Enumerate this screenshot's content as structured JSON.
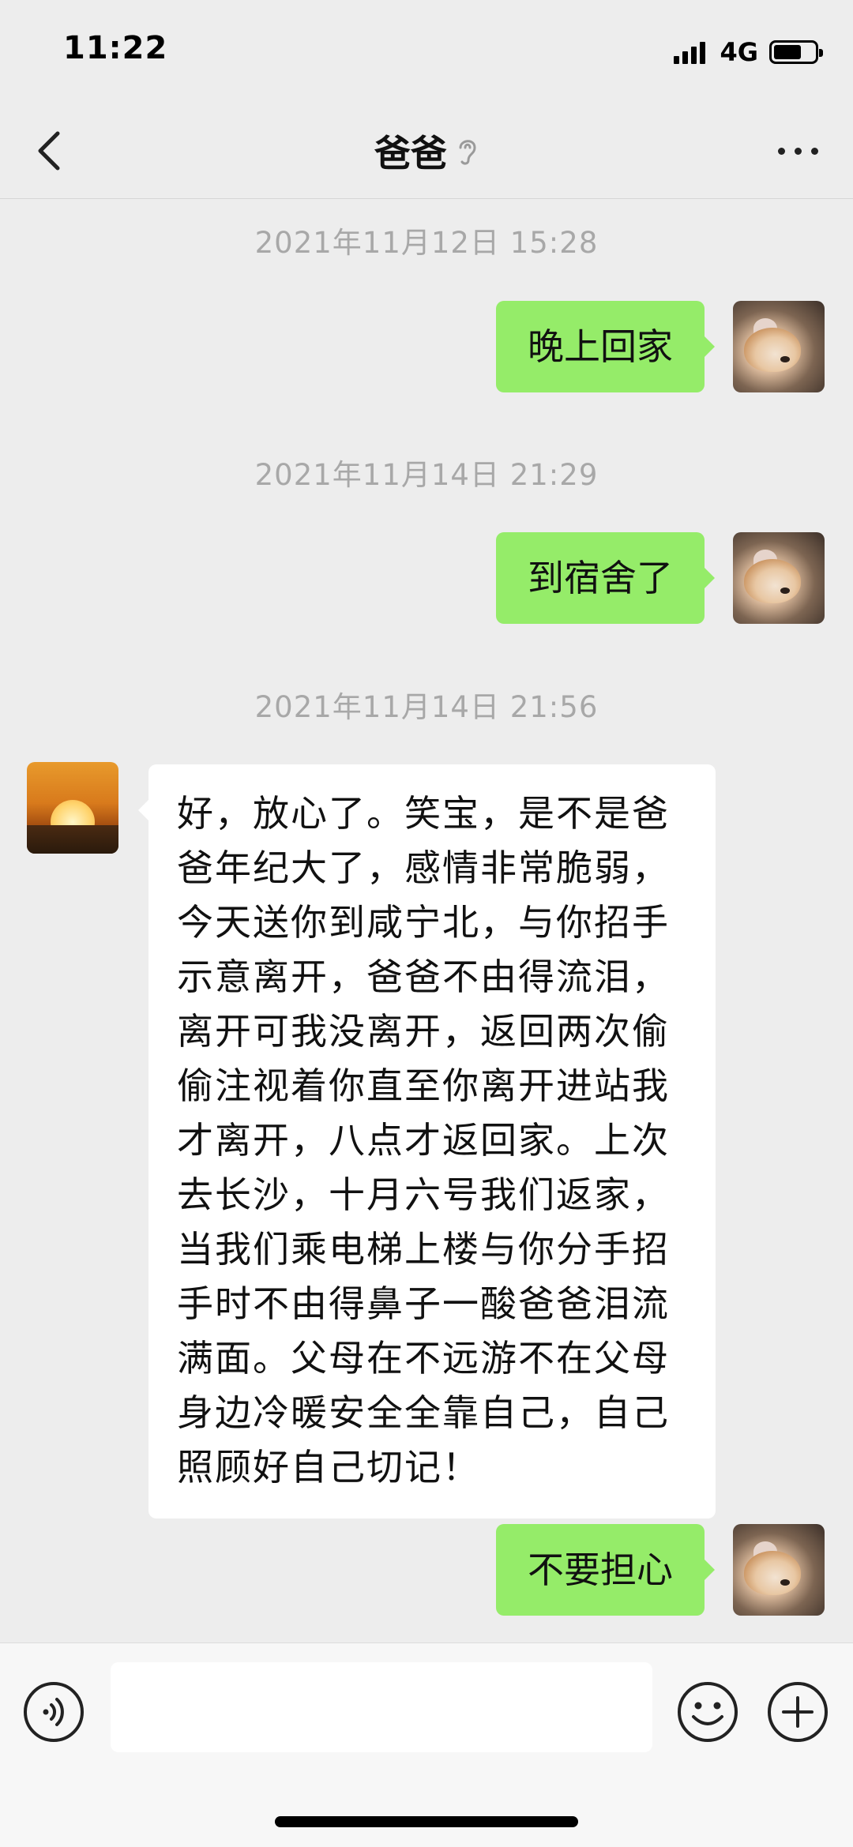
{
  "status_bar": {
    "time": "11:22",
    "network": "4G",
    "battery_level": 0.68,
    "signal_bars": 4
  },
  "header": {
    "back_icon": "chevron-left-icon",
    "title": "爸爸",
    "ear_icon": "ear-icon",
    "more_icon": "more-dots-icon"
  },
  "messages": [
    {
      "type": "timestamp",
      "text": "2021年11月12日 15:28"
    },
    {
      "type": "message",
      "from": "me",
      "text": "晚上回家"
    },
    {
      "type": "timestamp",
      "text": "2021年11月14日 21:29"
    },
    {
      "type": "message",
      "from": "me",
      "text": "到宿舍了"
    },
    {
      "type": "timestamp",
      "text": "2021年11月14日 21:56"
    },
    {
      "type": "message",
      "from": "dad",
      "lines": [
        "好，放心了。笑宝，是不是爸",
        "爸年纪大了，感情非常脆弱，",
        "今天送你到咸宁北，与你招手",
        "示意离开，爸爸不由得流泪，",
        "离开可我没离开，返回两次偷",
        "偷注视着你直至你离开进站我",
        "才离开，八点才返回家。上次",
        "去长沙，十月六号我们返家，",
        "当我们乘电梯上楼与你分手招",
        "手时不由得鼻子一酸爸爸泪流",
        "满面。父母在不远游不在父母",
        "身边冷暖安全全靠自己，自己",
        "照顾好自己切记！"
      ]
    },
    {
      "type": "message",
      "from": "me",
      "text": "不要担心"
    }
  ],
  "input_bar": {
    "voice_icon": "voice-icon",
    "input_value": "",
    "emoji_icon": "emoji-icon",
    "plus_icon": "plus-icon"
  },
  "colors": {
    "background": "#ededed",
    "my_bubble": "#95ec69",
    "their_bubble": "#ffffff",
    "timestamp_text": "#a8a8a8"
  }
}
